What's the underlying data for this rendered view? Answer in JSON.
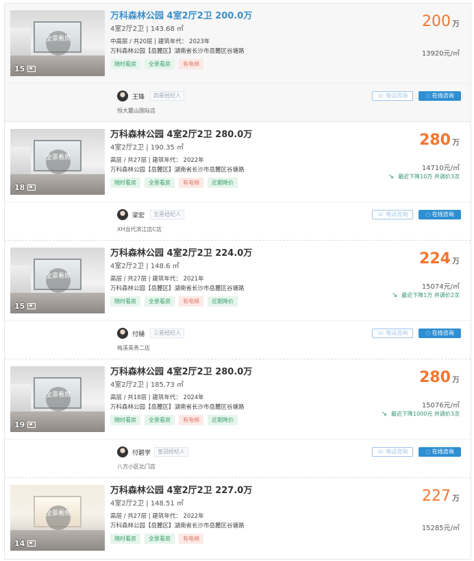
{
  "listings": [
    {
      "title": "万科森林公园 4室2厅2卫 200.0万",
      "layout_area": "4室2厅2卫 | 143.68 ㎡",
      "floor_year": "中高层 / 共20层 | 建筑年代： 2023年",
      "community_address": "万科森林公园【岳麓区】湖南省长沙市岳麓区谷塘路",
      "tags": [
        "随时看房",
        "全景看房",
        "有电梯"
      ],
      "photo_count": "15",
      "vr_label": "全景看房",
      "total_price": "200",
      "price_unit": "万",
      "unit_price": "13920元/㎡",
      "price_drop": "",
      "agent": {
        "name": "王锋",
        "rank": "四星经纪人",
        "shop": "恒大麓山国际店",
        "phone_btn": "电话咨询",
        "chat_btn": "在线咨询"
      }
    },
    {
      "title": "万科森林公园 4室2厅2卫 280.0万",
      "layout_area": "4室2厅2卫 | 190.35 ㎡",
      "floor_year": "高层 / 共27层 | 建筑年代： 2022年",
      "community_address": "万科森林公园【岳麓区】湖南省长沙市岳麓区谷塘路",
      "tags": [
        "随时看房",
        "全景看房",
        "有电梯",
        "近期降价"
      ],
      "photo_count": "18",
      "vr_label": "全景看房",
      "total_price": "280",
      "price_unit": "万",
      "unit_price": "14710元/㎡",
      "price_drop": "最近下降10万  共调价3次",
      "agent": {
        "name": "梁宏",
        "rank": "五星经纪人",
        "shop": "XH当代滨江店C店",
        "phone_btn": "电话咨询",
        "chat_btn": "在线咨询"
      }
    },
    {
      "title": "万科森林公园 4室2厅2卫 224.0万",
      "layout_area": "4室2厅2卫 | 148.6 ㎡",
      "floor_year": "高层 / 共27层 | 建筑年代： 2021年",
      "community_address": "万科森林公园【岳麓区】湖南省长沙市岳麓区谷塘路",
      "tags": [
        "随时看房",
        "全景看房",
        "有电梯",
        "近期降价"
      ],
      "photo_count": "15",
      "vr_label": "全景看房",
      "total_price": "224",
      "price_unit": "万",
      "unit_price": "15074元/㎡",
      "price_drop": "最近下降1万  共调价2次",
      "agent": {
        "name": "付樋",
        "rank": "三星经纪人",
        "shop": "梅溪青秀二店",
        "phone_btn": "电话咨询",
        "chat_btn": "在线咨询"
      }
    },
    {
      "title": "万科森林公园 4室2厅2卫 280.0万",
      "layout_area": "4室2厅2卫 | 185.73 ㎡",
      "floor_year": "高层 / 共18层 | 建筑年代： 2024年",
      "community_address": "万科森林公园【岳麓区】湖南省长沙市岳麓区谷塘路",
      "tags": [
        "随时看房",
        "全景看房",
        "有电梯",
        "近期降价"
      ],
      "photo_count": "19",
      "vr_label": "全景看房",
      "total_price": "280",
      "price_unit": "万",
      "unit_price": "15076元/㎡",
      "price_drop": "最近下降1000元  共调价3次",
      "agent": {
        "name": "付碧学",
        "rank": "皇冠经纪人",
        "shop": "八方小区北门店",
        "phone_btn": "电话咨询",
        "chat_btn": "在线咨询"
      }
    },
    {
      "title": "万科森林公园 4室2厅2卫 227.0万",
      "layout_area": "4室2厅2卫 | 148.51 ㎡",
      "floor_year": "高层 / 共27层 | 建筑年代： 2022年",
      "community_address": "万科森林公园【岳麓区】湖南省长沙市岳麓区谷塘路",
      "tags": [
        "随时看房",
        "全景看房",
        "有电梯"
      ],
      "photo_count": "14",
      "vr_label": "全景看房",
      "total_price": "227",
      "price_unit": "万",
      "unit_price": "15285元/㎡",
      "price_drop": ""
    }
  ]
}
